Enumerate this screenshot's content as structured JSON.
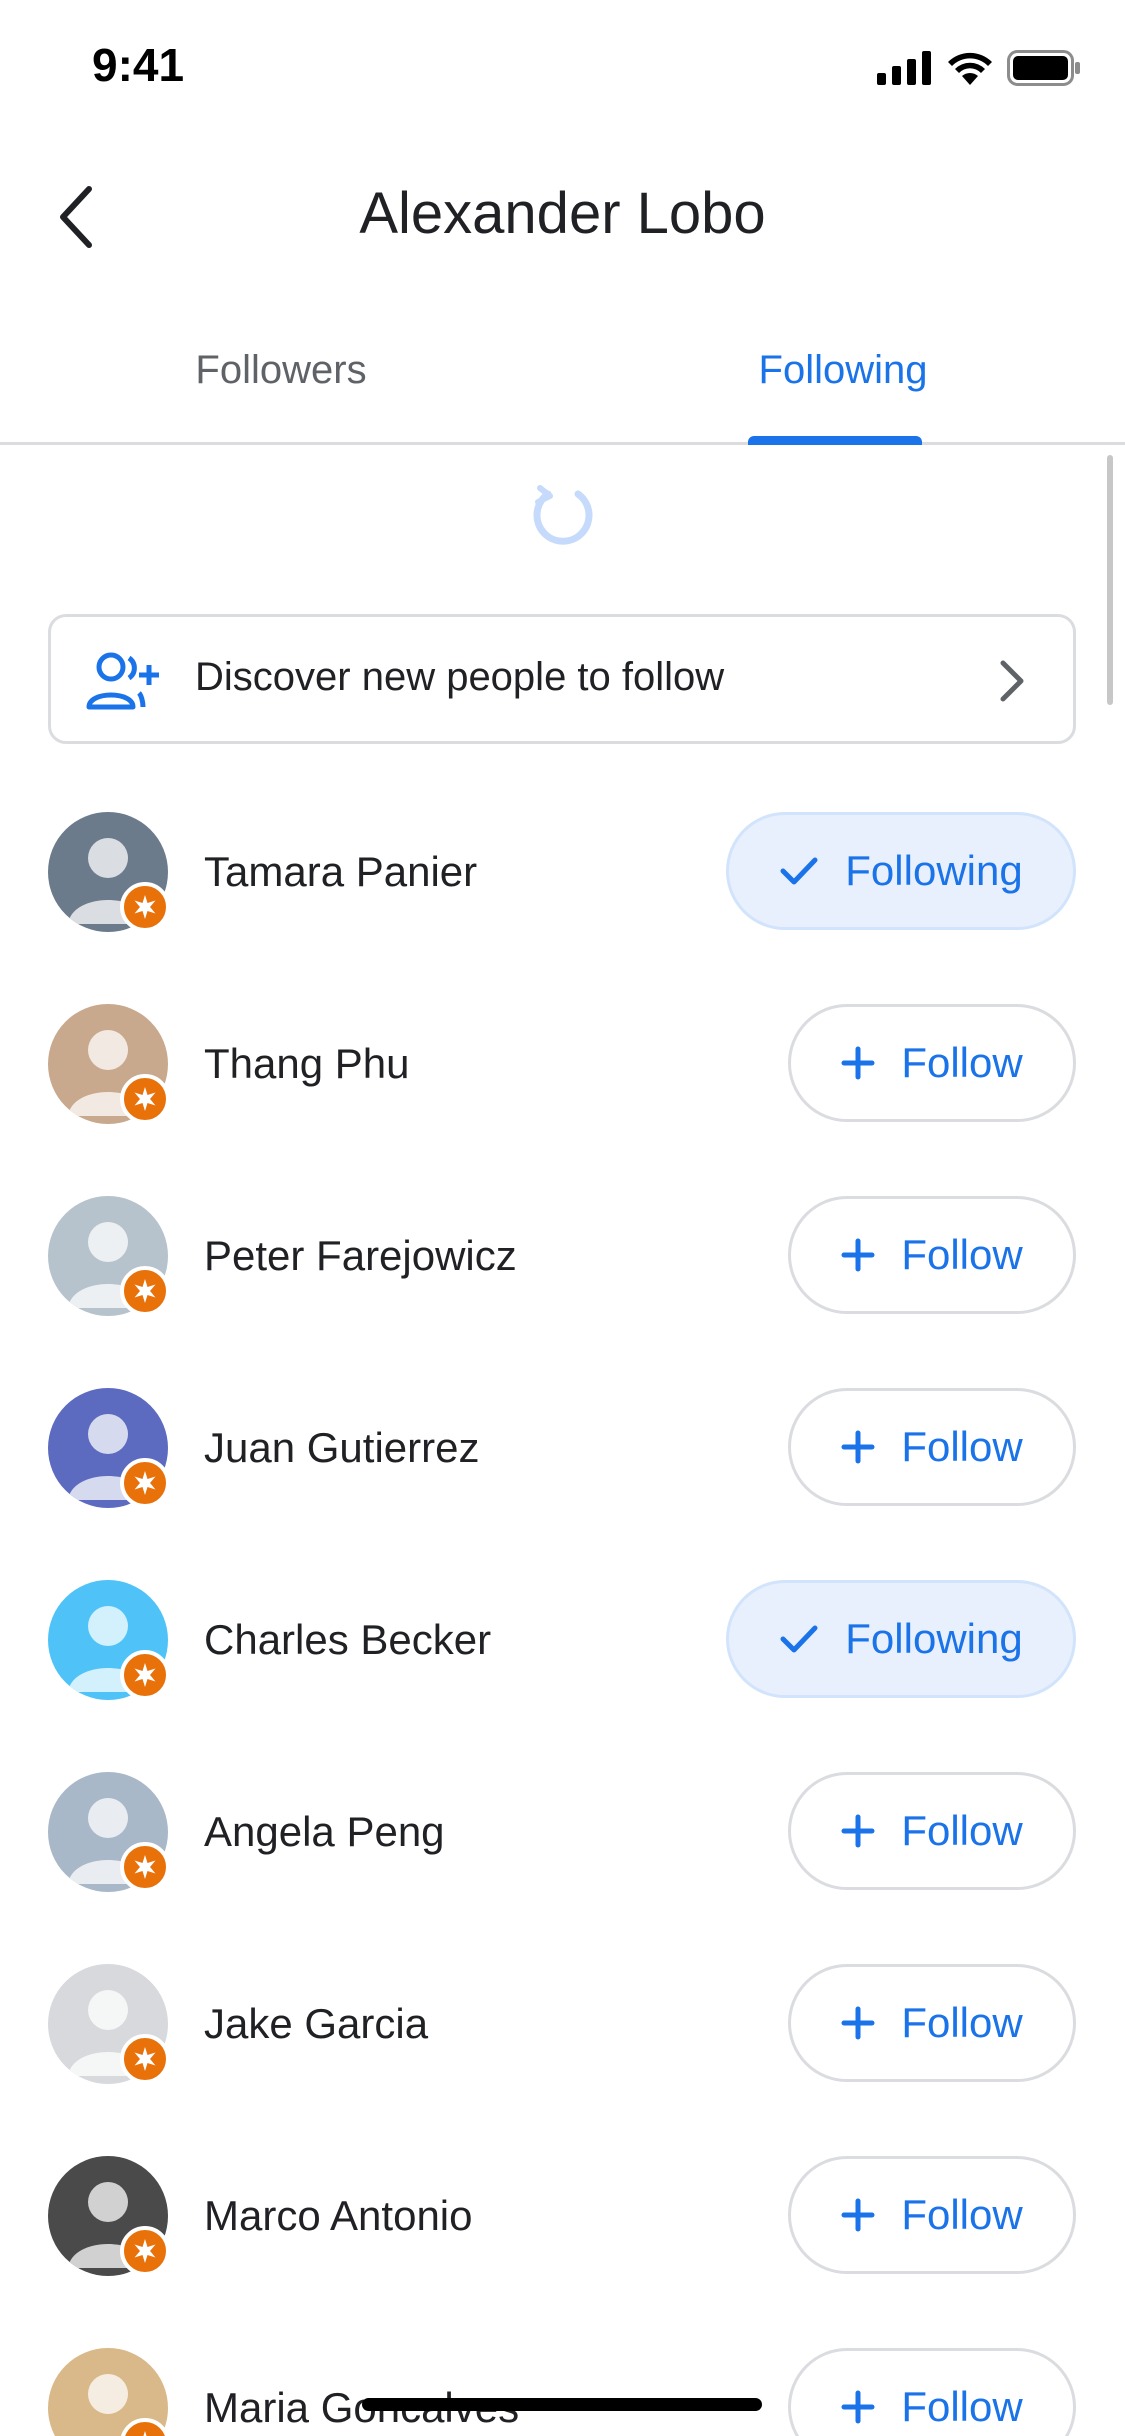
{
  "status_bar": {
    "time": "9:41"
  },
  "header": {
    "title": "Alexander Lobo"
  },
  "tabs": [
    {
      "label": "Followers",
      "selected": false
    },
    {
      "label": "Following",
      "selected": true
    }
  ],
  "discover": {
    "label": "Discover new people to follow"
  },
  "buttons": {
    "follow_label": "Follow",
    "following_label": "Following"
  },
  "people": [
    {
      "name": "Tamara Panier",
      "state": "following",
      "avatar_color": "#6b7b8c"
    },
    {
      "name": "Thang Phu",
      "state": "follow",
      "avatar_color": "#c9a98e"
    },
    {
      "name": "Peter Farejowicz",
      "state": "follow",
      "avatar_color": "#b7c3cc"
    },
    {
      "name": "Juan Gutierrez",
      "state": "follow",
      "avatar_color": "#5c6bc0"
    },
    {
      "name": "Charles Becker",
      "state": "following",
      "avatar_color": "#4fc3f7"
    },
    {
      "name": "Angela Peng",
      "state": "follow",
      "avatar_color": "#a9b8c8"
    },
    {
      "name": "Jake Garcia",
      "state": "follow",
      "avatar_color": "#d7d9dc"
    },
    {
      "name": "Marco Antonio",
      "state": "follow",
      "avatar_color": "#4a4a4a"
    },
    {
      "name": "Maria Goncalves",
      "state": "follow",
      "avatar_color": "#d9b98a"
    }
  ],
  "colors": {
    "accent": "#1a73e8",
    "badge": "#e8710a",
    "following_bg": "#e8f0fe"
  }
}
